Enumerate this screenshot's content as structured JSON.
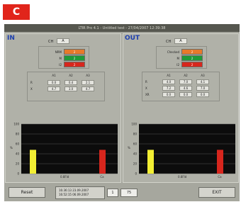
{
  "badge": "C",
  "window": {
    "title": "LTIR Pro 4.1 - Untitled test - 27/04/2007 12:39:38"
  },
  "colors": {
    "orange": "#e8792a",
    "green": "#1f9a38",
    "red": "#d7261d",
    "yellow": "#f2ee33"
  },
  "panels": [
    {
      "title": "IN",
      "channel_label": "CH",
      "channel_value": "A",
      "status": [
        {
          "label": "NRM",
          "text": "2",
          "color": "orange"
        },
        {
          "label": "M",
          "text": "2",
          "color": "green"
        },
        {
          "label": "I2",
          "text": "2",
          "color": "red"
        }
      ],
      "table_headers": [
        "A1",
        "A2",
        "A3"
      ],
      "table_rows": [
        {
          "label": "R",
          "values": [
            "0.0",
            "0.4",
            "2.1"
          ]
        },
        {
          "label": "X",
          "values": [
            "4.7",
            "3.0",
            "4.7"
          ]
        }
      ],
      "chart_data": {
        "type": "bar",
        "ylabel": "%",
        "yticks": [
          "100",
          "80",
          "60",
          "40",
          "20",
          "0"
        ],
        "ylim": [
          0,
          100
        ],
        "xlabels": [
          "0.8Fld",
          "Ca"
        ],
        "bars": [
          {
            "value": 48,
            "color": "yellow"
          },
          {
            "value": 48,
            "color": "red"
          }
        ]
      }
    },
    {
      "title": "OUT",
      "channel_label": "CH",
      "channel_value": "A",
      "status": [
        {
          "label": "Checked",
          "text": "2",
          "color": "orange"
        },
        {
          "label": "M",
          "text": "2",
          "color": "green"
        },
        {
          "label": "I2",
          "text": "2",
          "color": "red"
        }
      ],
      "table_headers": [
        "A1",
        "A2",
        "A3"
      ],
      "table_rows": [
        {
          "label": "R",
          "values": [
            "4.0",
            "7.0",
            "4.1"
          ]
        },
        {
          "label": "X",
          "values": [
            "7.2",
            "4.6",
            "7.0"
          ]
        },
        {
          "label": "XR",
          "values": [
            "0.0",
            "0.0",
            "0.0"
          ]
        }
      ],
      "chart_data": {
        "type": "bar",
        "ylabel": "%",
        "yticks": [
          "100",
          "80",
          "60",
          "40",
          "20",
          "0"
        ],
        "ylim": [
          0,
          100
        ],
        "xlabels": [
          "0.8Fld",
          "Ca"
        ],
        "bars": [
          {
            "value": 48,
            "color": "yellow"
          },
          {
            "value": 48,
            "color": "red"
          }
        ]
      }
    }
  ],
  "bottom": {
    "reset_label": "Reset",
    "datetime_lines": [
      "16:36:13 23.09.2007",
      "16:52:15 06.09.2007"
    ],
    "field1": "1",
    "field2": "75",
    "exit_label": "EXIT"
  }
}
